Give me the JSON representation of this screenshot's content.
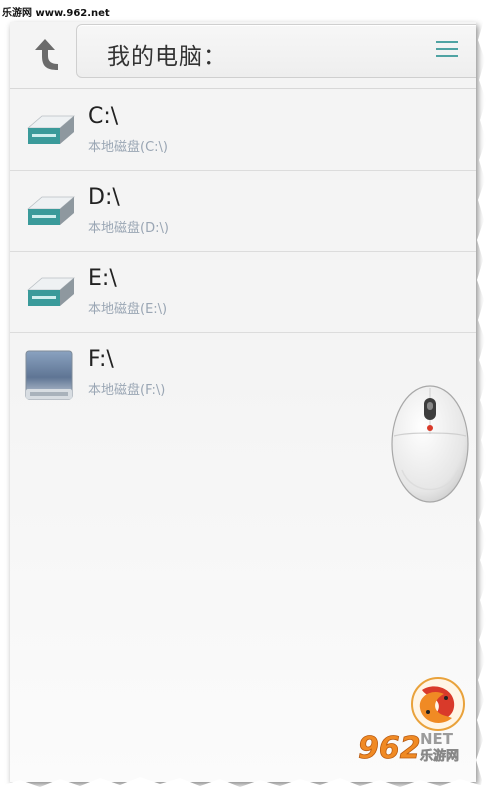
{
  "watermark": {
    "text": "乐游网 www.962.net"
  },
  "header": {
    "up_button": "up-arrow-icon",
    "path_title": "我的电脑：",
    "menu_icon": "hamburger-menu-icon"
  },
  "drives": [
    {
      "name": "C:\\",
      "label": "本地磁盘(C:\\)",
      "icon": "hard-drive-icon"
    },
    {
      "name": "D:\\",
      "label": "本地磁盘(D:\\)",
      "icon": "hard-drive-icon"
    },
    {
      "name": "E:\\",
      "label": "本地磁盘(E:\\)",
      "icon": "hard-drive-icon"
    },
    {
      "name": "F:\\",
      "label": "本地磁盘(F:\\)",
      "icon": "removable-drive-icon"
    }
  ],
  "overlay": {
    "cursor_icon": "computer-mouse-icon"
  },
  "logo": {
    "text_main": "962",
    "text_net": "NET",
    "text_cn": "乐游网"
  },
  "colors": {
    "background": "#f4f4f4",
    "drive_teal": "#3a9a9a",
    "subtitle": "#9aa6b4",
    "logo_orange": "#f08a24",
    "logo_red": "#d93a2a"
  }
}
